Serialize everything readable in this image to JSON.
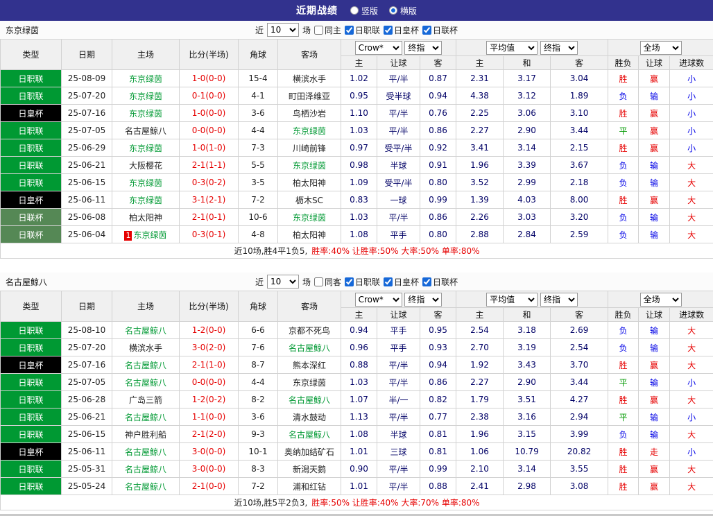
{
  "topbar": {
    "title": "近期战绩",
    "vertical": "竖版",
    "horizontal": "横版"
  },
  "controls": {
    "near": "近",
    "count": "10",
    "games": "场",
    "book_select": "Crow*",
    "final_select": "终指",
    "avg_select": "平均值",
    "full_select": "全场",
    "league_jl": "日职联",
    "league_cup": "日皇杯",
    "league_lc": "日联杯"
  },
  "table_header": {
    "type": "类型",
    "date": "日期",
    "home": "主场",
    "score": "比分(半场)",
    "corner": "角球",
    "away": "客场",
    "o_home": "主",
    "o_handicap": "让球",
    "o_away": "客",
    "e_home": "主",
    "e_draw": "和",
    "e_away": "客",
    "r_wdl": "胜负",
    "r_handicap": "让球",
    "r_goals": "进球数"
  },
  "colors": {
    "topbar_bg": "#32328e",
    "league_jleague": "#009933",
    "league_emperor_cup": "#000000",
    "league_league_cup": "#558855",
    "focus_team": "#009933",
    "score_red": "#e60000",
    "win_red": "#e60000",
    "lose_blue": "#0000e6",
    "draw_green": "#009900"
  },
  "sections": [
    {
      "team": "东京绿茵",
      "same_label": "同主",
      "rows": [
        {
          "league": "日职联",
          "date": "25-08-09",
          "home": "东京绿茵",
          "home_badge": "",
          "score": "1-0(0-0)",
          "corner": "15-4",
          "away": "横滨水手",
          "odds": [
            "1.02",
            "平/半",
            "0.87"
          ],
          "euro": [
            "2.31",
            "3.17",
            "3.04"
          ],
          "result": [
            "胜",
            "赢",
            "小"
          ]
        },
        {
          "league": "日职联",
          "date": "25-07-20",
          "home": "东京绿茵",
          "home_badge": "",
          "score": "0-1(0-0)",
          "corner": "4-1",
          "away": "町田泽维亚",
          "odds": [
            "0.95",
            "受半球",
            "0.94"
          ],
          "euro": [
            "4.38",
            "3.12",
            "1.89"
          ],
          "result": [
            "负",
            "输",
            "小"
          ]
        },
        {
          "league": "日皇杯",
          "date": "25-07-16",
          "home": "东京绿茵",
          "home_badge": "",
          "score": "1-0(0-0)",
          "corner": "3-6",
          "away": "鸟栖沙岩",
          "odds": [
            "1.10",
            "平/半",
            "0.76"
          ],
          "euro": [
            "2.25",
            "3.06",
            "3.10"
          ],
          "result": [
            "胜",
            "赢",
            "小"
          ]
        },
        {
          "league": "日职联",
          "date": "25-07-05",
          "home": "名古屋鲸八",
          "home_badge": "",
          "score": "0-0(0-0)",
          "corner": "4-4",
          "away": "东京绿茵",
          "odds": [
            "1.03",
            "平/半",
            "0.86"
          ],
          "euro": [
            "2.27",
            "2.90",
            "3.44"
          ],
          "result": [
            "平",
            "赢",
            "小"
          ]
        },
        {
          "league": "日职联",
          "date": "25-06-29",
          "home": "东京绿茵",
          "home_badge": "",
          "score": "1-0(1-0)",
          "corner": "7-3",
          "away": "川崎前锋",
          "odds": [
            "0.97",
            "受平/半",
            "0.92"
          ],
          "euro": [
            "3.41",
            "3.14",
            "2.15"
          ],
          "result": [
            "胜",
            "赢",
            "小"
          ]
        },
        {
          "league": "日职联",
          "date": "25-06-21",
          "home": "大阪樱花",
          "home_badge": "",
          "score": "2-1(1-1)",
          "corner": "5-5",
          "away": "东京绿茵",
          "odds": [
            "0.98",
            "半球",
            "0.91"
          ],
          "euro": [
            "1.96",
            "3.39",
            "3.67"
          ],
          "result": [
            "负",
            "输",
            "大"
          ]
        },
        {
          "league": "日职联",
          "date": "25-06-15",
          "home": "东京绿茵",
          "home_badge": "",
          "score": "0-3(0-2)",
          "corner": "3-5",
          "away": "柏太阳神",
          "odds": [
            "1.09",
            "受平/半",
            "0.80"
          ],
          "euro": [
            "3.52",
            "2.99",
            "2.18"
          ],
          "result": [
            "负",
            "输",
            "大"
          ]
        },
        {
          "league": "日皇杯",
          "date": "25-06-11",
          "home": "东京绿茵",
          "home_badge": "",
          "score": "3-1(2-1)",
          "corner": "7-2",
          "away": "枥木SC",
          "odds": [
            "0.83",
            "一球",
            "0.99"
          ],
          "euro": [
            "1.39",
            "4.03",
            "8.00"
          ],
          "result": [
            "胜",
            "赢",
            "大"
          ]
        },
        {
          "league": "日联杯",
          "date": "25-06-08",
          "home": "柏太阳神",
          "home_badge": "",
          "score": "2-1(0-1)",
          "corner": "10-6",
          "away": "东京绿茵",
          "odds": [
            "1.03",
            "平/半",
            "0.86"
          ],
          "euro": [
            "2.26",
            "3.03",
            "3.20"
          ],
          "result": [
            "负",
            "输",
            "大"
          ]
        },
        {
          "league": "日联杯",
          "date": "25-06-04",
          "home": "东京绿茵",
          "home_badge": "1",
          "score": "0-3(0-1)",
          "corner": "4-8",
          "away": "柏太阳神",
          "odds": [
            "1.08",
            "平手",
            "0.80"
          ],
          "euro": [
            "2.88",
            "2.84",
            "2.59"
          ],
          "result": [
            "负",
            "输",
            "大"
          ]
        }
      ],
      "summary_prefix": "近10场,胜4平1负5,",
      "summary_stats": "胜率:40% 让胜率:50% 大率:50% 单率:80%"
    },
    {
      "team": "名古屋鲸八",
      "same_label": "同客",
      "rows": [
        {
          "league": "日职联",
          "date": "25-08-10",
          "home": "名古屋鲸八",
          "home_badge": "",
          "score": "1-2(0-0)",
          "corner": "6-6",
          "away": "京都不死鸟",
          "odds": [
            "0.94",
            "平手",
            "0.95"
          ],
          "euro": [
            "2.54",
            "3.18",
            "2.69"
          ],
          "result": [
            "负",
            "输",
            "大"
          ]
        },
        {
          "league": "日职联",
          "date": "25-07-20",
          "home": "横滨水手",
          "home_badge": "",
          "score": "3-0(2-0)",
          "corner": "7-6",
          "away": "名古屋鲸八",
          "odds": [
            "0.96",
            "平手",
            "0.93"
          ],
          "euro": [
            "2.70",
            "3.19",
            "2.54"
          ],
          "result": [
            "负",
            "输",
            "大"
          ]
        },
        {
          "league": "日皇杯",
          "date": "25-07-16",
          "home": "名古屋鲸八",
          "home_badge": "",
          "score": "2-1(1-0)",
          "corner": "8-7",
          "away": "熊本深红",
          "odds": [
            "0.88",
            "平/半",
            "0.94"
          ],
          "euro": [
            "1.92",
            "3.43",
            "3.70"
          ],
          "result": [
            "胜",
            "赢",
            "大"
          ]
        },
        {
          "league": "日职联",
          "date": "25-07-05",
          "home": "名古屋鲸八",
          "home_badge": "",
          "score": "0-0(0-0)",
          "corner": "4-4",
          "away": "东京绿茵",
          "odds": [
            "1.03",
            "平/半",
            "0.86"
          ],
          "euro": [
            "2.27",
            "2.90",
            "3.44"
          ],
          "result": [
            "平",
            "输",
            "小"
          ]
        },
        {
          "league": "日职联",
          "date": "25-06-28",
          "home": "广岛三箭",
          "home_badge": "",
          "score": "1-2(0-2)",
          "corner": "8-2",
          "away": "名古屋鲸八",
          "odds": [
            "1.07",
            "半/一",
            "0.82"
          ],
          "euro": [
            "1.79",
            "3.51",
            "4.27"
          ],
          "result": [
            "胜",
            "赢",
            "大"
          ]
        },
        {
          "league": "日职联",
          "date": "25-06-21",
          "home": "名古屋鲸八",
          "home_badge": "",
          "score": "1-1(0-0)",
          "corner": "3-6",
          "away": "清水鼓动",
          "odds": [
            "1.13",
            "平/半",
            "0.77"
          ],
          "euro": [
            "2.38",
            "3.16",
            "2.94"
          ],
          "result": [
            "平",
            "输",
            "小"
          ]
        },
        {
          "league": "日职联",
          "date": "25-06-15",
          "home": "神户胜利船",
          "home_badge": "",
          "score": "2-1(2-0)",
          "corner": "9-3",
          "away": "名古屋鲸八",
          "odds": [
            "1.08",
            "半球",
            "0.81"
          ],
          "euro": [
            "1.96",
            "3.15",
            "3.99"
          ],
          "result": [
            "负",
            "输",
            "大"
          ]
        },
        {
          "league": "日皇杯",
          "date": "25-06-11",
          "home": "名古屋鲸八",
          "home_badge": "",
          "score": "3-0(0-0)",
          "corner": "10-1",
          "away": "奥纳加结矿石",
          "odds": [
            "1.01",
            "三球",
            "0.81"
          ],
          "euro": [
            "1.06",
            "10.79",
            "20.82"
          ],
          "result": [
            "胜",
            "走",
            "小"
          ]
        },
        {
          "league": "日职联",
          "date": "25-05-31",
          "home": "名古屋鲸八",
          "home_badge": "",
          "score": "3-0(0-0)",
          "corner": "8-3",
          "away": "新潟天鹅",
          "odds": [
            "0.90",
            "平/半",
            "0.99"
          ],
          "euro": [
            "2.10",
            "3.14",
            "3.55"
          ],
          "result": [
            "胜",
            "赢",
            "大"
          ]
        },
        {
          "league": "日职联",
          "date": "25-05-24",
          "home": "名古屋鲸八",
          "home_badge": "",
          "score": "2-1(0-0)",
          "corner": "7-2",
          "away": "浦和红钻",
          "odds": [
            "1.01",
            "平/半",
            "0.88"
          ],
          "euro": [
            "2.41",
            "2.98",
            "3.08"
          ],
          "result": [
            "胜",
            "赢",
            "大"
          ]
        }
      ],
      "summary_prefix": "近10场,胜5平2负3,",
      "summary_stats": "胜率:50% 让胜率:40% 大率:70% 单率:80%"
    }
  ]
}
